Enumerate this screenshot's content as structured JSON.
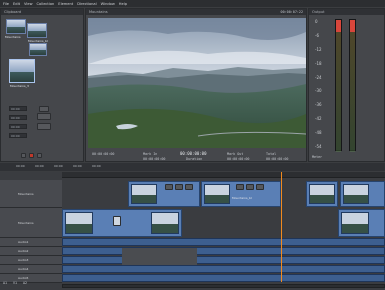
{
  "menu": [
    "File",
    "Edit",
    "View",
    "Collection",
    "Element",
    "Directional",
    "Window",
    "Help"
  ],
  "clipboard": {
    "title": "Clipboard",
    "items": [
      {
        "label": "Mountains"
      },
      {
        "label": "Mountains_bl"
      },
      {
        "label": "Mountains_2"
      },
      {
        "label": "Mountains_3"
      }
    ],
    "time_fields": [
      "00:00",
      "00:00",
      "00:00",
      "00:00"
    ]
  },
  "viewer": {
    "title": "Mountains",
    "timecode_top": "00:00:07:22",
    "status_left": "00:00:00:00",
    "mark_in_label": "Mark In",
    "mark_in_value": "00:00:00:00",
    "duration_label": "Duration",
    "duration_value": "00:00:00:00",
    "mark_out_label": "Mark Out",
    "mark_out_value": "00:00:00:00",
    "total_label": "Total",
    "total_value": "00:00:00:00"
  },
  "meter": {
    "title": "Output",
    "scale": [
      "0",
      "-6",
      "-12",
      "-18",
      "-24",
      "-30",
      "-36",
      "-42",
      "-48",
      "-54"
    ],
    "footer_label": "Meter"
  },
  "timeline": {
    "tabs": [
      "00:00",
      "00:00",
      "00:00",
      "00:00",
      "00:00"
    ],
    "track_labels": [
      "Mountains",
      "Mountains",
      "Audio1",
      "Audio2",
      "Audio3",
      "Audio4",
      "Audio5"
    ],
    "clip_labels": [
      "Mountains",
      "Mountains_bl",
      "Mountains_2"
    ],
    "footer": [
      "A1",
      "V1",
      "A2"
    ]
  },
  "colors": {
    "playhead": "#f08a1e",
    "clip": "#5a7fb5"
  }
}
